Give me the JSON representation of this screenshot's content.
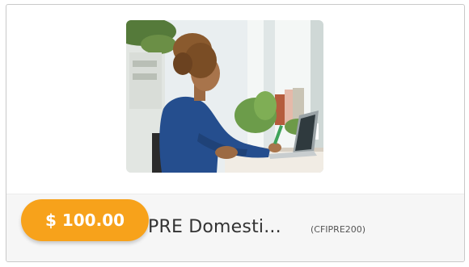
{
  "card": {
    "image_alt": "Woman working on laptop at desk",
    "price": "$ 100.00",
    "title": "PRE Domesti...",
    "code": "(CFIPRE200)"
  },
  "colors": {
    "badge": "#f7a21b",
    "footer_bg": "#f6f6f6",
    "border": "#c9c9c9"
  },
  "icons": {
    "photo": "course-photo"
  }
}
